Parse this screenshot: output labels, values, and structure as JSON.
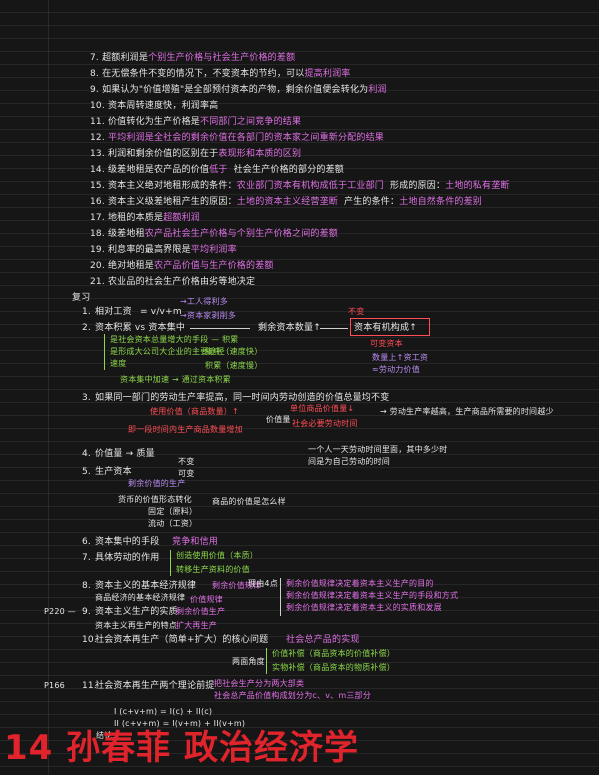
{
  "list": [
    {
      "num": "7.",
      "text": "超额利润是",
      "hl": "个别生产价格与社会生产价格的差额",
      "hl_color": "pink"
    },
    {
      "num": "8.",
      "text": "在无偿条件不变的情况下，不变资本的节约，可以",
      "hl": "提高利润率",
      "hl_color": "pink"
    },
    {
      "num": "9.",
      "text": "如果认为\"价值增殖\"是全部预付资本的产物，剩余价值便会转化为",
      "hl": "利润",
      "hl_color": "pink"
    },
    {
      "num": "10.",
      "text": "资本周转速度快，利润率高",
      "hl": "",
      "hl_color": "none"
    },
    {
      "num": "11.",
      "text": "价值转化为生产价格是",
      "hl": "不同部门之间竞争的结果",
      "hl_color": "pink"
    },
    {
      "num": "12.",
      "text": "",
      "hl": "平均利润是全社会的剩余价值在各部门的资本家之间重新分配的结果",
      "hl_color": "pink"
    },
    {
      "num": "13.",
      "text": "利润和剩余价值的区别在于",
      "hl": "表现形和本质的区别",
      "hl_color": "pink"
    },
    {
      "num": "14.",
      "text": "级差地租是农产品的价值",
      "hl": "低于",
      "hl_color": "pink",
      "text2": "社会生产价格的部分的差额"
    },
    {
      "num": "15.",
      "text": "资本主义绝对地租形成的条件：",
      "hl": "农业部门资本有机构成低于工业部门",
      "hl_color": "pink",
      "text2": "形成的原因：",
      "hl2": "土地的私有垄断"
    },
    {
      "num": "16.",
      "text": "资本主义级差地租产生的原因：",
      "hl": "土地的资本主义经营垄断",
      "hl_color": "pink",
      "text2": "产生的条件：",
      "hl2": "土地自然条件的差别"
    },
    {
      "num": "17.",
      "text": "地租的本质是",
      "hl": "超额利润",
      "hl_color": "pink"
    },
    {
      "num": "18.",
      "text": "级差地租",
      "hl": "农产品社会生产价格与个别生产价格之间的差额",
      "hl_color": "pink"
    },
    {
      "num": "19.",
      "text": "利息率的最高界限是",
      "hl": "平均利润率",
      "hl_color": "pink"
    },
    {
      "num": "20.",
      "text": "绝对地租是",
      "hl": "农产品价值与生产价格的差额",
      "hl_color": "pink"
    },
    {
      "num": "21.",
      "text": "农业品的社会生产价格由劣等地决定",
      "hl": "",
      "hl_color": "none"
    }
  ],
  "review": {
    "title": "复习",
    "r1": {
      "num": "1.",
      "text": "相对工资",
      "formula": "= v/v+m",
      "note1": "→工人得利多",
      "note2": "→资本家剥削多"
    },
    "r2": {
      "num": "2.",
      "text": "资本积累 vs 资本集中",
      "mid": "剩余资本数量↑",
      "right": "资本有机构成↑",
      "r_note1": "可变资本",
      "r_note2": "数量上↑资工资",
      "r_note3": "≈劳动力价值",
      "r_star": "不变",
      "g1": "是社会资本总量增大的手段 — 积累",
      "g2": "是形成大公司大企业的主要途径",
      "g3": "速度",
      "g4": "集中（速度快）",
      "g5": "积累（速度慢）",
      "g6": "资本集中加速 → 通过资本积累"
    },
    "r3": {
      "num": "3.",
      "text": "如果同一部门的劳动生产率提高，同一时间内劳动创造的价值总量均不变",
      "a": "使用价值（商品数量）↑",
      "b": "单位商品价值量↓",
      "c": "即一段时间内生产商品数量增加",
      "d": "价值量",
      "e": "→ 劳动生产率越高，生产商品所需要的时间越少",
      "f": "社会必要劳动时间"
    },
    "r4": {
      "num": "4.",
      "text": "价值量 → 质量",
      "right": "一个人一天劳动时间里面，其中多少时间是为自己劳动的时间"
    },
    "r5": {
      "num": "5.",
      "text": "生产资本",
      "a": "不变",
      "b": "可变",
      "c": "剩余价值的生产",
      "d": "货币的价值形态转化",
      "e": "固定（原料）",
      "f": "流动（工资）",
      "g": "商品的价值是怎么样"
    },
    "r6": {
      "num": "6.",
      "text": "资本集中的手段",
      "hl": "竞争和信用"
    },
    "r7": {
      "num": "7.",
      "text": "具体劳动的作用",
      "a": "创造使用价值（本质）",
      "b": "转移生产资料的价值"
    },
    "r8": {
      "num": "8.",
      "text": "资本主义的基本经济规律",
      "a": "剩余价值规律",
      "b": "商品经济的基本经济规律",
      "c": "价值规律",
      "d": "理由4点",
      "e": "剩余价值规律决定着资本主义生产的目的",
      "f": "剩余价值规律决定着资本主义生产的手段和方式",
      "g": "剩余价值规律决定着资本主义的实质和发展"
    },
    "r9": {
      "num": "9.",
      "text": "资本主义生产的实质",
      "a": "剩余价值生产",
      "b": "资本主义再生产的特点",
      "c": "扩大再生产",
      "side": "P220 —"
    },
    "r10": {
      "num": "10.",
      "text": "社会资本再生产（简单+扩大）的核心问题",
      "hl": "社会总产品的实现",
      "side_a": "两面角度",
      "side_b": "价值补偿（商品资本的价值补偿）",
      "side_c": "实物补偿（商品资本的物质补偿）"
    },
    "r11": {
      "num": "11.",
      "text": "社会资本再生产两个理论前提",
      "a": "把社会生产分为两大部类",
      "b": "社会总产品价值构成划分为c、v、m三部分",
      "side": "P166"
    },
    "formulas": [
      "I (c+v+m) = I(c) + II(c)",
      "II (c+v+m) = I(v+m) + II(v+m)",
      "结论:"
    ]
  },
  "banner": "14 孙春菲 政治经济学"
}
